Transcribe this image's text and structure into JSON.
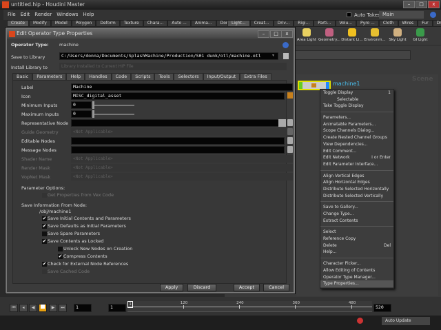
{
  "window": {
    "title": "untitled.hip - Houdini Master",
    "min": "–",
    "max": "□",
    "close": "x"
  },
  "menu": [
    "File",
    "Edit",
    "Render",
    "Windows",
    "Help"
  ],
  "auto_takes": "Auto Takes",
  "takes_dropdown": "Main",
  "shelf_tabs_left": [
    "Create",
    "Modify",
    "Model",
    "Polygon",
    "Deform",
    "Texture",
    "Chara...",
    "Auto ...",
    "Anima...",
    "Donna"
  ],
  "shelf_tabs_right": [
    "Light...",
    "Creat...",
    "Driv...",
    "Rigi...",
    "Parti...",
    "Volu...",
    "Pyro ...",
    "Cloth",
    "Wires",
    "Fur",
    "Driv..."
  ],
  "shelf_tools": [
    {
      "label": "Area Light",
      "color": "#e8d060"
    },
    {
      "label": "Geometry...",
      "color": "#c06080"
    },
    {
      "label": "Distant Li...",
      "color": "#f0c020"
    },
    {
      "label": "Environm...",
      "color": "#e8c030"
    },
    {
      "label": "Sky Light",
      "color": "#d0b080"
    },
    {
      "label": "GI Light",
      "color": "#3a9a4a"
    }
  ],
  "network": {
    "pane_label": "Scene",
    "node_name": "machine1"
  },
  "dialog": {
    "title": "Edit Operator Type Properties",
    "operator_type_label": "Operator Type:",
    "operator_type": "machine",
    "save_to_library_label": "Save to Library",
    "save_to_library": "C:/Users/donna/Documents/SplashMachine/Production/S01 dunk/otl/machine.otl",
    "install_library_label": "Install Library to",
    "install_library": "Library Installed to Current HIP File",
    "tabs": [
      "Basic",
      "Parameters",
      "Help",
      "Handles",
      "Code",
      "Scripts",
      "Tools",
      "Selectors",
      "Input/Output",
      "Extra Files"
    ],
    "fields": {
      "label": {
        "label": "Label",
        "value": "Machine"
      },
      "icon": {
        "label": "Icon",
        "value": "MISC_digital_asset"
      },
      "min_inputs": {
        "label": "Minimum Inputs",
        "value": "0"
      },
      "max_inputs": {
        "label": "Maximum Inputs",
        "value": "0"
      },
      "rep_node": {
        "label": "Representative Node",
        "value": ""
      },
      "guide_geo": {
        "label": "Guide Geometry",
        "value": "<Not Applicable>"
      },
      "editable_nodes": {
        "label": "Editable Nodes",
        "value": ""
      },
      "message_nodes": {
        "label": "Message Nodes",
        "value": ""
      },
      "shader_name": {
        "label": "Shader Name",
        "value": "<Not Applicable>"
      },
      "render_mask": {
        "label": "Render Mask",
        "value": "<Not Applicable>"
      },
      "vopnet_mask": {
        "label": "VopNet Mask",
        "value": "<Not Applicable>"
      }
    },
    "param_options_label": "Parameter Options:",
    "get_props_vex": {
      "label": "Get Properties from Vex Code",
      "checked": false
    },
    "save_info_label": "Save Information From Node:",
    "node_path": "/obj/machine1",
    "checks": [
      {
        "label": "Save Initial Contents and Parameters",
        "checked": true
      },
      {
        "label": "Save Defaults as Initial Parameters",
        "checked": true
      },
      {
        "label": "Save Spare Parameters",
        "checked": false
      },
      {
        "label": "Save Contents as Locked",
        "checked": true
      },
      {
        "label": "Unlock New Nodes on Creation",
        "checked": false
      },
      {
        "label": "Compress Contents",
        "checked": true
      },
      {
        "label": "Check for External Node References",
        "checked": true
      },
      {
        "label": "Save Cached Code",
        "checked": false
      }
    ],
    "buttons": {
      "apply": "Apply",
      "discard": "Discard",
      "accept": "Accept",
      "cancel": "Cancel"
    }
  },
  "context_menu": [
    [
      {
        "label": "Toggle Display",
        "shortcut": "1"
      },
      {
        "label": "Selectable",
        "shortcut": ""
      },
      {
        "label": "Take Toggle Display",
        "shortcut": ""
      }
    ],
    [
      {
        "label": "Parameters...",
        "shortcut": ""
      },
      {
        "label": "Animatable Parameters...",
        "shortcut": ""
      },
      {
        "label": "Scope Channels Dialog...",
        "shortcut": ""
      },
      {
        "label": "Create Nested Channel Groups",
        "shortcut": ""
      },
      {
        "label": "View Dependencies...",
        "shortcut": ""
      },
      {
        "label": "Edit Comment...",
        "shortcut": ""
      },
      {
        "label": "Edit Network",
        "shortcut": "I or Enter"
      },
      {
        "label": "Edit Parameter Interface...",
        "shortcut": ""
      }
    ],
    [
      {
        "label": "Align Vertical Edges",
        "shortcut": ""
      },
      {
        "label": "Align Horizontal Edges",
        "shortcut": ""
      },
      {
        "label": "Distribute Selected Horizontally",
        "shortcut": ""
      },
      {
        "label": "Distribute Selected Vertically",
        "shortcut": ""
      }
    ],
    [
      {
        "label": "Save to Gallery...",
        "shortcut": ""
      },
      {
        "label": "Change Type...",
        "shortcut": ""
      },
      {
        "label": "Extract Contents",
        "shortcut": ""
      }
    ],
    [
      {
        "label": "Select",
        "shortcut": ""
      },
      {
        "label": "Reference Copy",
        "shortcut": ""
      },
      {
        "label": "Delete",
        "shortcut": "Del"
      },
      {
        "label": "Help...",
        "shortcut": ""
      }
    ],
    [
      {
        "label": "Character Picker...",
        "shortcut": ""
      },
      {
        "label": "Allow Editing of Contents",
        "shortcut": ""
      },
      {
        "label": "Operator Type Manager...",
        "shortcut": ""
      },
      {
        "label": "Type Properties...",
        "shortcut": ""
      }
    ]
  ],
  "timeline": {
    "current_frame": "1",
    "step": "1",
    "start": "1",
    "end": "520",
    "ticks": [
      "120",
      "240",
      "360",
      "480"
    ],
    "frame_marker": "1"
  },
  "status": {
    "update_mode": "Auto Update"
  }
}
